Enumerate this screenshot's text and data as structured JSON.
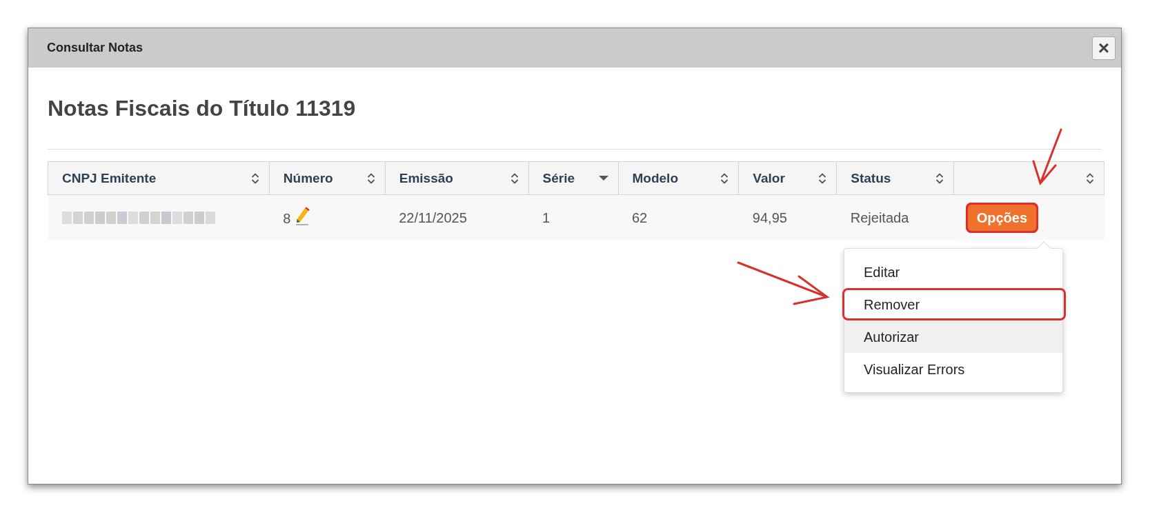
{
  "dialog": {
    "title": "Consultar Notas",
    "close": "×"
  },
  "heading": "Notas Fiscais do Título 11319",
  "table": {
    "columns": [
      {
        "label": "CNPJ Emitente",
        "sorted": false
      },
      {
        "label": "Número",
        "sorted": false
      },
      {
        "label": "Emissão",
        "sorted": false
      },
      {
        "label": "Série",
        "sorted": true
      },
      {
        "label": "Modelo",
        "sorted": false
      },
      {
        "label": "Valor",
        "sorted": false
      },
      {
        "label": "Status",
        "sorted": false
      },
      {
        "sorted": false
      }
    ],
    "rows": [
      {
        "cells": [
          {
            "kind": "redacted"
          },
          {
            "kind": "editable",
            "text": "8"
          },
          {
            "kind": "text",
            "text": "22/11/2025"
          },
          {
            "kind": "text",
            "text": "1"
          },
          {
            "kind": "text",
            "text": "62"
          },
          {
            "kind": "text",
            "text": "94,95"
          },
          {
            "kind": "text",
            "text": "Rejeitada"
          },
          {
            "kind": "menu",
            "text": "Opções",
            "annotated": true
          }
        ]
      }
    ]
  },
  "menu": {
    "items": [
      {
        "label": "Editar",
        "hovered": false,
        "annotated": false
      },
      {
        "label": "Remover",
        "hovered": false,
        "annotated": true
      },
      {
        "label": "Autorizar",
        "hovered": true,
        "annotated": false
      },
      {
        "label": "Visualizar Errors",
        "hovered": false,
        "annotated": false
      }
    ]
  }
}
